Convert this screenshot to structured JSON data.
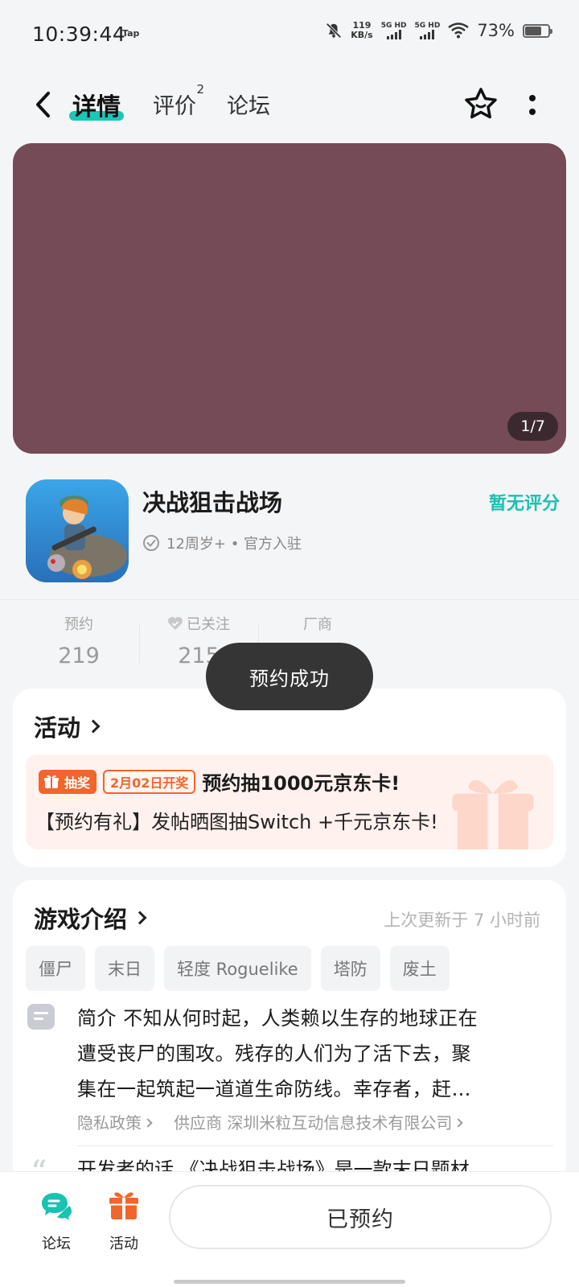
{
  "status_bar": {
    "time": "10:39:44",
    "app_badge": "Tap",
    "net_speed_value": "119",
    "net_speed_unit": "KB/s",
    "sim1": "5G HD",
    "sim2": "5G HD",
    "battery_text": "73%",
    "battery_level": 0.73
  },
  "nav": {
    "tabs": [
      {
        "label": "详情",
        "active": true
      },
      {
        "label": "评价",
        "badge": "2"
      },
      {
        "label": "论坛"
      }
    ],
    "icons": [
      "back-icon",
      "star-icon",
      "more-icon"
    ]
  },
  "banner": {
    "counter": "1/7",
    "color": "#744b56"
  },
  "game": {
    "title": "决战狙击战场",
    "meta": "12周岁+ • 官方入驻",
    "rating": "暂无评分"
  },
  "stats": [
    {
      "label": "预约",
      "value": "219"
    },
    {
      "label": "已关注",
      "value": "215"
    },
    {
      "label": "厂商",
      "value": ""
    }
  ],
  "toast": "预约成功",
  "activity": {
    "header": "活动",
    "badge_label": "抽奖",
    "date": "2月02日开奖",
    "title": "预约抽1000元京东卡!",
    "subtitle": "【预约有礼】发帖晒图抽Switch +千元京东卡!"
  },
  "intro": {
    "header": "游戏介绍",
    "updated": "上次更新于 7 小时前",
    "tags": [
      "僵尸",
      "末日",
      "轻度 Roguelike",
      "塔防",
      "废土"
    ],
    "description_lines": [
      "简介 不知从何时起，人类赖以生存的地球正在",
      "遭受丧尸的围攻。残存的人们为了活下去，聚",
      "集在一起筑起一道道生命防线。幸存者，赶…"
    ],
    "privacy": "隐私政策",
    "supplier": "供应商 深圳米粒互动信息技术有限公司",
    "developer_words": "开发者的话 《决战狙击战场》是一款末日题材"
  },
  "bottom": {
    "forum_label": "论坛",
    "activity_label": "活动",
    "reserve_button": "已预约"
  },
  "colors": {
    "accent": "#19c7b8",
    "orange": "#f2652b",
    "banner": "#744b56"
  }
}
